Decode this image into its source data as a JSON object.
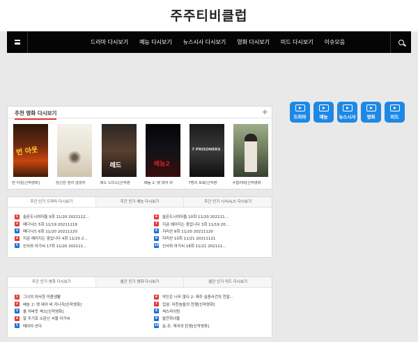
{
  "site": {
    "title": "주주티비클럽"
  },
  "nav": {
    "items": [
      "드라마 다시보기",
      "예능 다시보기",
      "뉴스시사 다시보기",
      "영화 다시보기",
      "미드 다시보기",
      "이슈모음"
    ]
  },
  "movies": {
    "title": "추천 영화 다시보기",
    "items": [
      "번 아웃[신작영화]",
      "당신은 엄지 않겠지",
      "레드 노티스[신작영",
      "베놈 2: 렛 데어 비",
      "7명의 포로[신작영",
      "수험러버[신작영화"
    ]
  },
  "quick_icons": [
    "드라마",
    "예능",
    "뉴스시사",
    "영화",
    "미드"
  ],
  "weekly": {
    "tabs": [
      "주간 인기 드라마 다시보기",
      "주간 인기 예능 다시보기",
      "주간 인기 시사/뉴스 다시보기"
    ],
    "left": [
      {
        "rank": "1",
        "text": "슬픈도시여자들 9회 11/20 2021112…"
      },
      {
        "rank": "2",
        "text": "메디닉스 5회 11/19 20211119"
      },
      {
        "rank": "3",
        "text": "메디닉스 6회 11/20 20211120"
      },
      {
        "rank": "4",
        "text": "지금 헤어지는 중입니다 4회 11/20 2…"
      },
      {
        "rank": "5",
        "text": "신사와 아가씨 17회 11/20 202111…"
      }
    ],
    "right": [
      {
        "rank": "6",
        "text": "슬픈도시여자들 10회 11/20 202111…"
      },
      {
        "rank": "7",
        "text": "지금 헤어지는 중입니다 3회 11/19 20…"
      },
      {
        "rank": "8",
        "text": "지리산 9회 11/20 20211120"
      },
      {
        "rank": "9",
        "text": "지리산 10회 11/21 20211121"
      },
      {
        "rank": "10",
        "text": "신사와 아가씨 18회 11/21 202111…"
      }
    ]
  },
  "monthly": {
    "tabs": [
      "주간 인기 영화 다시보기",
      "월간 인기 영화 다시보기",
      "월간 인기 미드 다시보기"
    ],
    "left": [
      {
        "rank": "1",
        "text": "그녀의 여사한 미용생활"
      },
      {
        "rank": "2",
        "text": "베놈 2: 렛 데어 비 카니지[신작영화]"
      },
      {
        "rank": "3",
        "text": "올 어바웃 섹스[신작영화]"
      },
      {
        "rank": "4",
        "text": "잘 주기로 소문난 서울 아가씨"
      },
      {
        "rank": "5",
        "text": "때려야 산다"
      }
    ],
    "right": [
      {
        "rank": "6",
        "text": "악인은 너무 많다 2: 제주 실종사건의 전말…"
      },
      {
        "rank": "7",
        "text": "킵섬: 미친놈들의 전쟁[신작영화]"
      },
      {
        "rank": "8",
        "text": "섹스라이팅"
      },
      {
        "rank": "9",
        "text": "발칸하녀들"
      },
      {
        "rank": "10",
        "text": "듄:조: 케국의 탄생[신작영화]"
      }
    ]
  },
  "colors": {
    "nav_bg": "#050505",
    "accent_blue": "#1e88e5",
    "rank_red": "#e53935",
    "rank_blue": "#1e6fd9"
  }
}
